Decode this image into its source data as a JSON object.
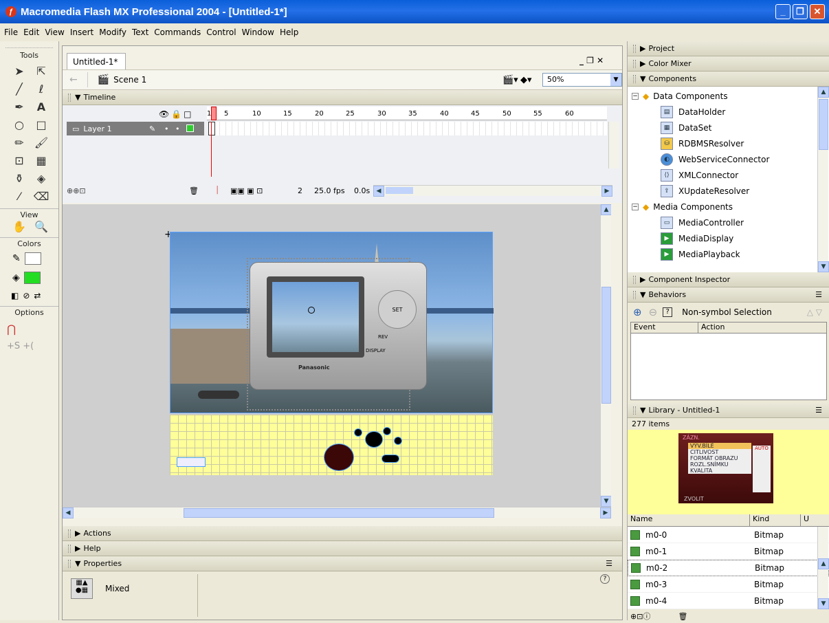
{
  "window": {
    "title": "Macromedia Flash MX Professional 2004 - [Untitled-1*]",
    "btn_min": "_",
    "btn_max": "❐",
    "btn_close": "✕"
  },
  "menu": [
    "File",
    "Edit",
    "View",
    "Insert",
    "Modify",
    "Text",
    "Commands",
    "Control",
    "Window",
    "Help"
  ],
  "tools": {
    "title": "Tools",
    "view": "View",
    "colors": "Colors",
    "options": "Options"
  },
  "document": {
    "tab": "Untitled-1*",
    "scene": "Scene 1",
    "zoom": "50%",
    "doc_controls": "_ ❐ ✕"
  },
  "timeline": {
    "title": "Timeline",
    "layer_name": "Layer 1",
    "frame_numbers": [
      "1",
      "5",
      "10",
      "15",
      "20",
      "25",
      "30",
      "35",
      "40",
      "45",
      "50",
      "55",
      "60"
    ],
    "current_frame": "2",
    "fps": "25.0 fps",
    "time": "0.0s"
  },
  "panels_bottom": {
    "actions": "Actions",
    "help": "Help",
    "properties": "Properties",
    "prop_value": "Mixed",
    "help_icon": "?"
  },
  "side": {
    "project": "Project",
    "color_mixer": "Color Mixer",
    "components": "Components",
    "groups": [
      {
        "name": "Data Components",
        "items": [
          "DataHolder",
          "DataSet",
          "RDBMSResolver",
          "WebServiceConnector",
          "XMLConnector",
          "XUpdateResolver"
        ]
      },
      {
        "name": "Media Components",
        "items": [
          "MediaController",
          "MediaDisplay",
          "MediaPlayback"
        ]
      }
    ],
    "component_inspector": "Component Inspector",
    "behaviors": "Behaviors",
    "behaviors_status": "Non-symbol Selection",
    "behaviors_cols": [
      "Event",
      "Action"
    ],
    "library": "Library - Untitled-1",
    "library_count": "277 items",
    "library_cols": [
      "Name",
      "Kind",
      "U"
    ],
    "library_rows": [
      {
        "name": "m0-0",
        "kind": "Bitmap"
      },
      {
        "name": "m0-1",
        "kind": "Bitmap"
      },
      {
        "name": "m0-2",
        "kind": "Bitmap"
      },
      {
        "name": "m0-3",
        "kind": "Bitmap"
      },
      {
        "name": "m0-4",
        "kind": "Bitmap"
      }
    ],
    "preview_menu": [
      "VÝV.BÍLÉ",
      "CITLIVOST",
      "FORMÁT OBRAZU",
      "ROZL.SNÍMKU",
      "KVALITA"
    ],
    "preview_header": "ZÁZN.",
    "preview_footer": "ZVOLIT",
    "preview_auto": "AUTO"
  },
  "camera": {
    "brand": "Panasonic",
    "display": "DISPLAY",
    "rev": "REV",
    "set": "SET"
  },
  "colors": {
    "title_bar": "#0a5fd8",
    "stage_grid": "#ffff9a",
    "swatch_fill": "#22dd22"
  }
}
